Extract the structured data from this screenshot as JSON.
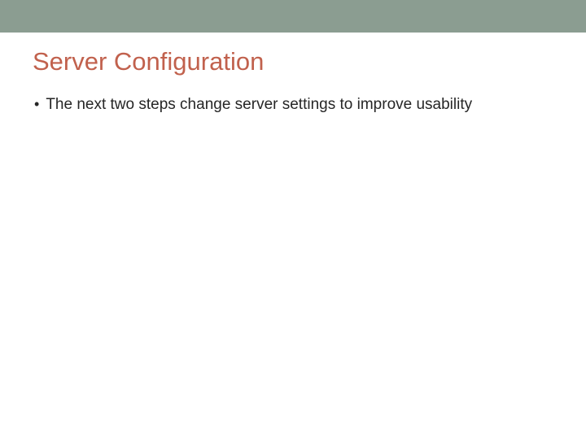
{
  "slide": {
    "title": "Server Configuration",
    "bullets": [
      {
        "text": "The next two steps change server settings to improve usability"
      }
    ]
  },
  "colors": {
    "topBar": "#8b9d91",
    "title": "#c1614d",
    "body": "#262626"
  }
}
